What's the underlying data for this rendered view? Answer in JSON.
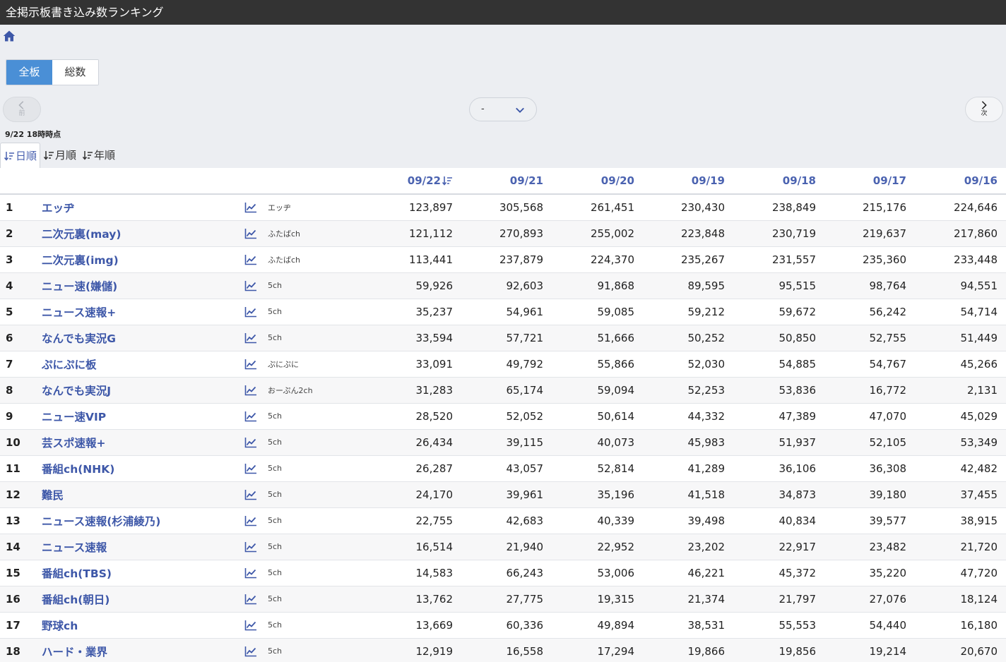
{
  "app": {
    "title": "全掲示板書き込み数ランキング"
  },
  "icons": {
    "home": "home-icon",
    "trend": "trend-chart-icon",
    "sort": "sort-descending-icon"
  },
  "colors": {
    "accent": "#4a8fd6",
    "link": "#3d57a8",
    "header": "#333333"
  },
  "segment": {
    "all_label": "全板",
    "total_label": "総数"
  },
  "nav": {
    "prev_label": "前",
    "next_label": "次",
    "select_value": "-"
  },
  "as_of": "9/22 18時時点",
  "tabs": [
    {
      "label": "日順"
    },
    {
      "label": "月順"
    },
    {
      "label": "年順"
    }
  ],
  "table": {
    "columns": [
      "09/22",
      "09/21",
      "09/20",
      "09/19",
      "09/18",
      "09/17",
      "09/16"
    ],
    "rows": [
      {
        "rank": "1",
        "name": "エッヂ",
        "category": "エッヂ",
        "values": [
          "123,897",
          "305,568",
          "261,451",
          "230,430",
          "238,849",
          "215,176",
          "224,646"
        ]
      },
      {
        "rank": "2",
        "name": "二次元裏(may)",
        "category": "ふたばch",
        "values": [
          "121,112",
          "270,893",
          "255,002",
          "223,848",
          "230,719",
          "219,637",
          "217,860"
        ]
      },
      {
        "rank": "3",
        "name": "二次元裏(img)",
        "category": "ふたばch",
        "values": [
          "113,441",
          "237,879",
          "224,370",
          "235,267",
          "231,557",
          "235,360",
          "233,448"
        ]
      },
      {
        "rank": "4",
        "name": "ニュー速(嫌儲)",
        "category": "5ch",
        "values": [
          "59,926",
          "92,603",
          "91,868",
          "89,595",
          "95,515",
          "98,764",
          "94,551"
        ]
      },
      {
        "rank": "5",
        "name": "ニュース速報+",
        "category": "5ch",
        "values": [
          "35,237",
          "54,961",
          "59,085",
          "59,212",
          "59,672",
          "56,242",
          "54,714"
        ]
      },
      {
        "rank": "6",
        "name": "なんでも実況G",
        "category": "5ch",
        "values": [
          "33,594",
          "57,721",
          "51,666",
          "50,252",
          "50,850",
          "52,755",
          "51,449"
        ]
      },
      {
        "rank": "7",
        "name": "ぷにぷに板",
        "category": "ぷにぷに",
        "values": [
          "33,091",
          "49,792",
          "55,866",
          "52,030",
          "54,885",
          "54,767",
          "45,266"
        ]
      },
      {
        "rank": "8",
        "name": "なんでも実況J",
        "category": "おーぷん2ch",
        "values": [
          "31,283",
          "65,174",
          "59,094",
          "52,253",
          "53,836",
          "16,772",
          "2,131"
        ]
      },
      {
        "rank": "9",
        "name": "ニュー速VIP",
        "category": "5ch",
        "values": [
          "28,520",
          "52,052",
          "50,614",
          "44,332",
          "47,389",
          "47,070",
          "45,029"
        ]
      },
      {
        "rank": "10",
        "name": "芸スポ速報+",
        "category": "5ch",
        "values": [
          "26,434",
          "39,115",
          "40,073",
          "45,983",
          "51,937",
          "52,105",
          "53,349"
        ]
      },
      {
        "rank": "11",
        "name": "番組ch(NHK)",
        "category": "5ch",
        "values": [
          "26,287",
          "43,057",
          "52,814",
          "41,289",
          "36,106",
          "36,308",
          "42,482"
        ]
      },
      {
        "rank": "12",
        "name": "難民",
        "category": "5ch",
        "values": [
          "24,170",
          "39,961",
          "35,196",
          "41,518",
          "34,873",
          "39,180",
          "37,455"
        ]
      },
      {
        "rank": "13",
        "name": "ニュース速報(杉浦綾乃)",
        "category": "5ch",
        "values": [
          "22,755",
          "42,683",
          "40,339",
          "39,498",
          "40,834",
          "39,577",
          "38,915"
        ]
      },
      {
        "rank": "14",
        "name": "ニュース速報",
        "category": "5ch",
        "values": [
          "16,514",
          "21,940",
          "22,952",
          "23,202",
          "22,917",
          "23,482",
          "21,720"
        ]
      },
      {
        "rank": "15",
        "name": "番組ch(TBS)",
        "category": "5ch",
        "values": [
          "14,583",
          "66,243",
          "53,006",
          "46,221",
          "45,372",
          "35,220",
          "47,720"
        ]
      },
      {
        "rank": "16",
        "name": "番組ch(朝日)",
        "category": "5ch",
        "values": [
          "13,762",
          "27,775",
          "19,315",
          "21,374",
          "21,797",
          "27,076",
          "18,124"
        ]
      },
      {
        "rank": "17",
        "name": "野球ch",
        "category": "5ch",
        "values": [
          "13,669",
          "60,336",
          "49,894",
          "38,531",
          "55,553",
          "54,440",
          "16,180"
        ]
      },
      {
        "rank": "18",
        "name": "ハード・業界",
        "category": "5ch",
        "values": [
          "12,919",
          "16,558",
          "17,294",
          "19,866",
          "19,856",
          "19,214",
          "20,670"
        ]
      }
    ]
  }
}
